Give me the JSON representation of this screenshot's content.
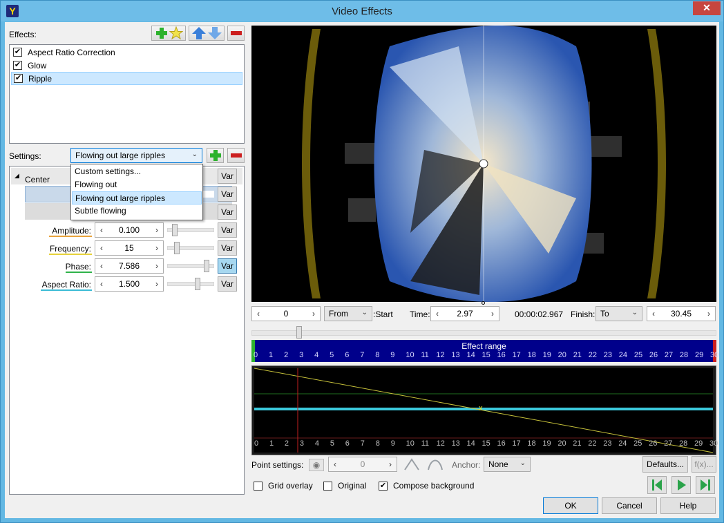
{
  "window": {
    "title": "Video Effects",
    "close": "✕"
  },
  "effects": {
    "label": "Effects:",
    "items": [
      {
        "label": "Aspect Ratio Correction",
        "checked": true
      },
      {
        "label": "Glow",
        "checked": true
      },
      {
        "label": "Ripple",
        "checked": true
      }
    ]
  },
  "settings": {
    "label": "Settings:",
    "selected": "Flowing out large ripples",
    "options": [
      "Custom settings...",
      "Flowing out",
      "Flowing out large ripples",
      "Subtle flowing"
    ]
  },
  "properties": {
    "group": "Center",
    "var_label": "Var",
    "params": [
      {
        "label": "Amplitude:",
        "value": "0.100",
        "level": 0.1,
        "color": "#e8a33d"
      },
      {
        "label": "Frequency:",
        "value": "15",
        "level": 0.15,
        "color": "#e6d23a"
      },
      {
        "label": "Phase:",
        "value": "7.586",
        "level": 0.85,
        "color": "#2fb34a"
      },
      {
        "label": "Aspect Ratio:",
        "value": "1.500",
        "level": 0.6,
        "color": "#3bbcd6"
      }
    ]
  },
  "time_controls": {
    "frame_value": "0",
    "from_select": "From",
    "start_label": ":Start",
    "time_label": "Time:",
    "time_value": "2.97",
    "timecode": "00:00:02.967",
    "finish_label": "Finish:",
    "to_select": "To",
    "finish_value": "30.45"
  },
  "effect_range": {
    "label": "Effect range",
    "ticks": [
      "0",
      "1",
      "2",
      "3",
      "4",
      "5",
      "6",
      "7",
      "8",
      "9",
      "10",
      "11",
      "12",
      "13",
      "14",
      "15",
      "16",
      "17",
      "18",
      "19",
      "20",
      "21",
      "22",
      "23",
      "24",
      "25",
      "26",
      "27",
      "28",
      "29",
      "30"
    ]
  },
  "graph": {
    "marker": "x"
  },
  "point_settings": {
    "label": "Point settings:",
    "value": "0",
    "anchor_label": "Anchor:",
    "anchor_value": "None",
    "defaults_button": "Defaults...",
    "fx_button": "f(x)..."
  },
  "options": {
    "grid_overlay": {
      "label": "Grid overlay",
      "checked": false
    },
    "original": {
      "label": "Original",
      "checked": false
    },
    "compose_background": {
      "label": "Compose background",
      "checked": true
    }
  },
  "footer": {
    "ok": "OK",
    "cancel": "Cancel",
    "help": "Help"
  },
  "colors": {
    "accent_blue": "#3a7fd9",
    "add_green": "#2db22d",
    "remove_red": "#cc1f1f",
    "timeline": "#00008b"
  }
}
